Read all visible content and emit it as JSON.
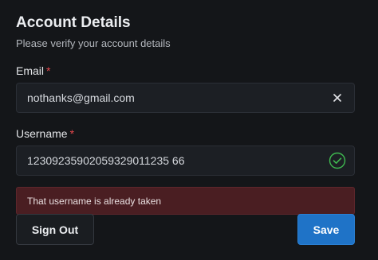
{
  "header": {
    "title": "Account Details",
    "subtitle": "Please verify your account details"
  },
  "email": {
    "label": "Email",
    "required_mark": "*",
    "value": "nothanks@gmail.com",
    "clear_icon": "close-icon"
  },
  "username": {
    "label": "Username",
    "required_mark": "*",
    "value": "12309235902059329011235 66",
    "status_icon": "check-circle-icon"
  },
  "error": {
    "message": "That username is already taken"
  },
  "actions": {
    "sign_out_label": "Sign Out",
    "save_label": "Save"
  },
  "colors": {
    "background": "#141619",
    "accent": "#1f73c7",
    "required": "#e5484d",
    "success": "#3fb950",
    "error_bg": "#4a1e22"
  }
}
